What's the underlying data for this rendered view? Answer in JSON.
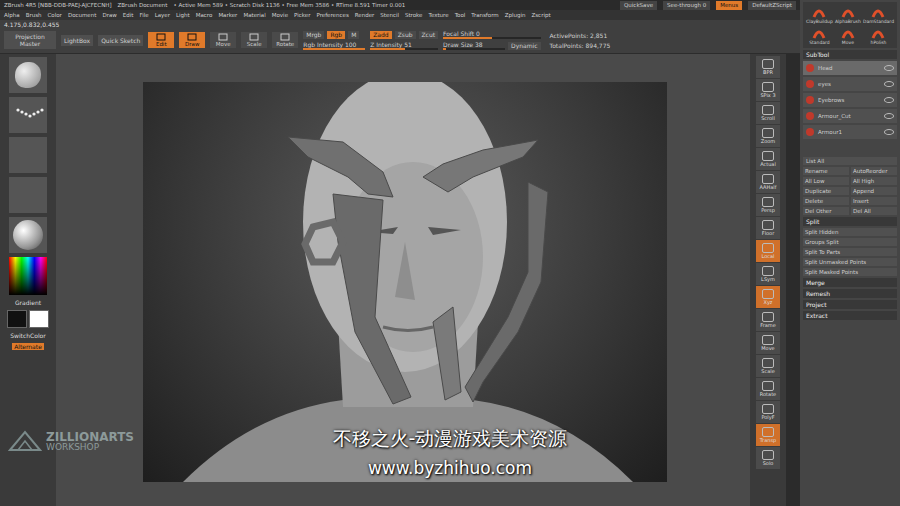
{
  "title_bar": {
    "app": "ZBrush 4R5 [NBB-DDB-PAEJ-AJCFECNH]",
    "document": "ZBrush Document",
    "stats": "• Active Mem 589 • Scratch Disk 1136 • Free Mem 3586 • RTime 8.591 Timer 0.001",
    "buttons": [
      {
        "label": "QuickSave",
        "selected": false
      },
      {
        "label": "See-through 0",
        "selected": false
      },
      {
        "label": "Menus",
        "selected": true
      },
      {
        "label": "DefaultZScript",
        "selected": false
      }
    ]
  },
  "menu": [
    "Alpha",
    "Brush",
    "Color",
    "Document",
    "Draw",
    "Edit",
    "File",
    "Layer",
    "Light",
    "Macro",
    "Marker",
    "Material",
    "Movie",
    "Picker",
    "Preferences",
    "Render",
    "Stencil",
    "Stroke",
    "Texture",
    "Tool",
    "Transform",
    "Zplugin",
    "Zscript"
  ],
  "coordinates": "4.175,0.832,0.455",
  "toolbar": {
    "launch": [
      {
        "label": "Projection Master"
      },
      {
        "label": "LightBox"
      },
      {
        "label": "Quick Sketch"
      }
    ],
    "modes": [
      {
        "label": "Edit",
        "selected": true
      },
      {
        "label": "Draw",
        "selected": true
      },
      {
        "label": "Move",
        "selected": false
      },
      {
        "label": "Scale",
        "selected": false
      },
      {
        "label": "Rotate",
        "selected": false
      }
    ],
    "color_modes": [
      {
        "label": "Mrgb",
        "selected": false
      },
      {
        "label": "Rgb",
        "selected": true
      },
      {
        "label": "M",
        "selected": false
      }
    ],
    "rgb_intensity": {
      "label": "Rgb Intensity",
      "value": "100",
      "level": 1.0
    },
    "z_modes": [
      {
        "label": "Zadd",
        "selected": true
      },
      {
        "label": "Zsub",
        "selected": false
      },
      {
        "label": "Zcut",
        "selected": false
      }
    ],
    "z_intensity": {
      "label": "Z Intensity",
      "value": "51",
      "level": 0.51
    },
    "focal_shift": {
      "label": "Focal Shift",
      "value": "0",
      "level": 0.5
    },
    "draw_size": {
      "label": "Draw Size",
      "value": "38",
      "level": 0.04
    },
    "dynamic": {
      "label": "Dynamic",
      "selected": false
    },
    "active_points": "ActivePoints: 2,851",
    "total_points": "TotalPoints: 894,775"
  },
  "left_shelf": {
    "thumbs": [
      {
        "kind": "brush"
      },
      {
        "kind": "stroke"
      },
      {
        "kind": "alpha"
      },
      {
        "kind": "texture"
      },
      {
        "kind": "material"
      }
    ],
    "gradient": "Gradient",
    "swatches": [
      {
        "color": "#111111"
      },
      {
        "color": "#ffffff"
      }
    ],
    "switch_color": "SwitchColor",
    "alternate": {
      "label": "Alternate",
      "selected": true
    }
  },
  "right_shelf": [
    {
      "label": "BPR",
      "selected": false
    },
    {
      "label": "SPix 3",
      "selected": false
    },
    {
      "label": "Scroll",
      "selected": false
    },
    {
      "label": "Zoom",
      "selected": false
    },
    {
      "label": "Actual",
      "selected": false
    },
    {
      "label": "AAHalf",
      "selected": false
    },
    {
      "label": "Persp",
      "selected": false
    },
    {
      "label": "Floor",
      "selected": false
    },
    {
      "label": "Local",
      "selected": true
    },
    {
      "label": "LSym",
      "selected": false
    },
    {
      "label": "Xyz",
      "selected": true
    },
    {
      "label": "Frame",
      "selected": false
    },
    {
      "label": "Move",
      "selected": false
    },
    {
      "label": "Scale",
      "selected": false
    },
    {
      "label": "Rotate",
      "selected": false
    },
    {
      "label": "PolyF",
      "selected": false
    },
    {
      "label": "Transp",
      "selected": true
    },
    {
      "label": "Solo",
      "selected": false
    }
  ],
  "brushes": [
    {
      "label": "ClayBuildup"
    },
    {
      "label": "AlphaBrush"
    },
    {
      "label": "DamStandard"
    },
    {
      "label": "Standard"
    },
    {
      "label": "Move"
    },
    {
      "label": "hPolish"
    }
  ],
  "subtool": {
    "title": "SubTool",
    "items": [
      {
        "name": "Head",
        "selected": true
      },
      {
        "name": "eyes",
        "selected": false
      },
      {
        "name": "Eyebrows",
        "selected": false
      },
      {
        "name": "Armour_Cut",
        "selected": false
      },
      {
        "name": "Armour1",
        "selected": false
      }
    ],
    "list_all": "List All",
    "buttons": [
      "Rename",
      "AutoReorder",
      "All Low",
      "All High",
      "Duplicate",
      "Append",
      "Delete",
      "Insert",
      "Del Other",
      "Del All"
    ],
    "split_title": "Split",
    "split_buttons": [
      "Split Hidden",
      "Groups Split",
      "Split To Parts",
      "Split Unmasked Points",
      "Split Masked Points"
    ],
    "sections": [
      "Merge",
      "Remesh",
      "Project",
      "Extract"
    ]
  },
  "logo": {
    "line1": "ZILLIONARTS",
    "line2": "WORKSHOP"
  },
  "watermark": {
    "title": "不移之火-动漫游戏美术资源",
    "url": "www.byzhihuo.com"
  }
}
